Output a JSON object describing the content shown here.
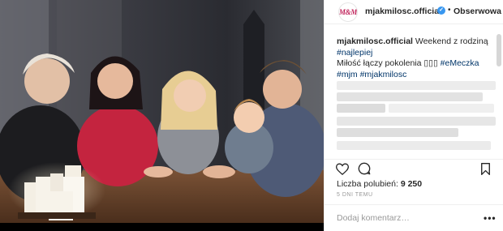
{
  "post": {
    "image_alt": "family-photo",
    "header": {
      "avatar_text": "M&M",
      "handle": "mjakmilosc.official",
      "separator": "•",
      "follow_label": "Obserwowa"
    },
    "caption": {
      "author": "mjakmilosc.official",
      "line1_text": " Weekend z rodziną",
      "tag_najlepiej": "#najlepiej",
      "line3_text": "Miłość łączy pokolenia ",
      "line3_emoji": "▯▯▯",
      "tag_emeczka": "#eMeczka",
      "tag_mjm": "#mjm",
      "tag_mjakmilosc": "#mjakmilosc"
    },
    "actions": {
      "like_icon": "heart-icon",
      "comment_icon": "comment-icon",
      "save_icon": "bookmark-icon"
    },
    "likes_label": "Liczba polubień: ",
    "likes_count": "9 250",
    "timestamp": "5 DNI TEMU",
    "comment_placeholder": "Dodaj komentarz…",
    "more_label": "•••"
  },
  "colors": {
    "accent_link": "#003569",
    "verified_blue": "#3897f0",
    "border": "#efefef",
    "muted": "#999999"
  }
}
